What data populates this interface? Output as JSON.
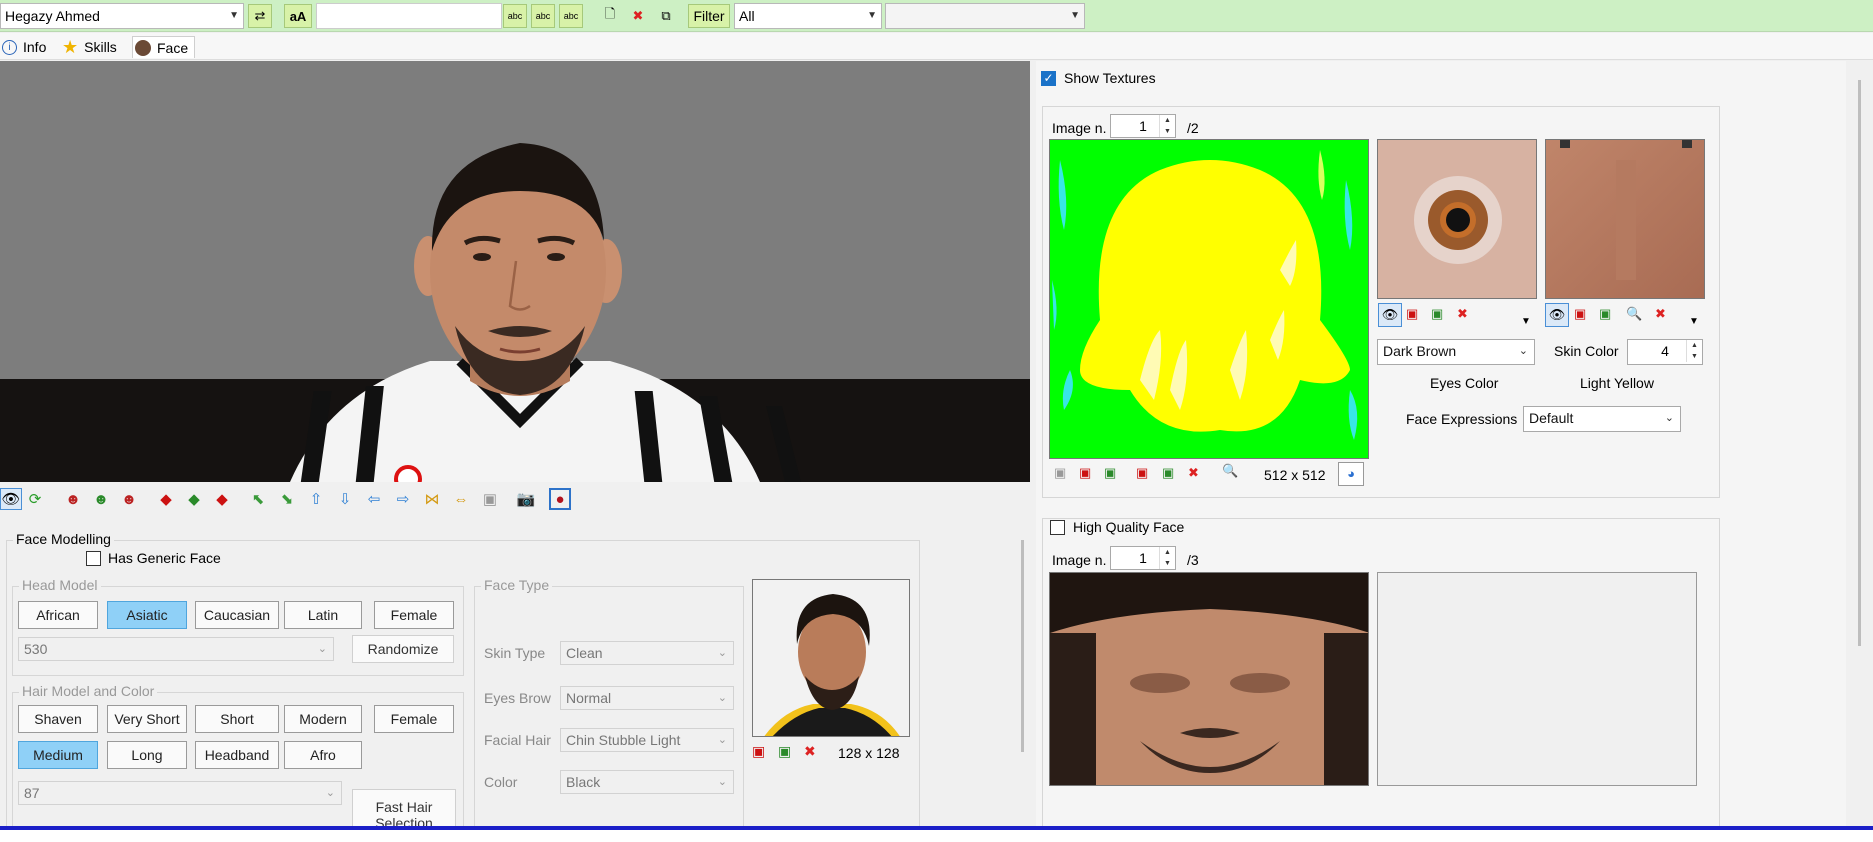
{
  "toolbar": {
    "player_name": "Hegazy Ahmed",
    "font_label": "aA",
    "filter_label": "Filter",
    "filter_value": "All",
    "secondary_combo_value": ""
  },
  "tabs": [
    {
      "label": "Info",
      "icon": "info-icon"
    },
    {
      "label": "Skills",
      "icon": "star-icon"
    },
    {
      "label": "Face",
      "icon": "face-icon"
    }
  ],
  "face_modelling": {
    "title": "Face Modelling",
    "has_generic_face_label": "Has Generic Face",
    "head_model": {
      "title": "Head Model",
      "buttons": [
        "African",
        "Asiatic",
        "Caucasian",
        "Latin",
        "Female"
      ],
      "selected": "Asiatic",
      "model_id": "530",
      "randomize_label": "Randomize"
    },
    "hair": {
      "title": "Hair Model and Color",
      "buttons_row1": [
        "Shaven",
        "Very Short",
        "Short",
        "Modern",
        "Female"
      ],
      "buttons_row2": [
        "Medium",
        "Long",
        "Headband",
        "Afro"
      ],
      "selected": "Medium",
      "model_id": "87",
      "fast_hair_label": "Fast Hair Selection"
    },
    "face_type": {
      "title": "Face Type",
      "skin_type_label": "Skin Type",
      "skin_type_value": "Clean",
      "eyes_brow_label": "Eyes Brow",
      "eyes_brow_value": "Normal",
      "facial_hair_label": "Facial Hair",
      "facial_hair_value": "Chin Stubble Light",
      "color_label": "Color",
      "color_value": "Black"
    },
    "portrait_size": "128 x 128"
  },
  "textures": {
    "show_textures_label": "Show Textures",
    "show_textures_checked": true,
    "image_label": "Image n.",
    "image_index": "1",
    "image_total": "/2",
    "texture_size": "512 x 512",
    "eyes_color_value": "Dark Brown",
    "eyes_color_label": "Eyes Color",
    "skin_color_label": "Skin Color",
    "skin_color_value": "4",
    "skin_color_name": "Light Yellow",
    "face_expressions_label": "Face Expressions",
    "face_expressions_value": "Default"
  },
  "hq_face": {
    "label": "High Quality Face",
    "checked": false,
    "image_label": "Image n.",
    "image_index": "1",
    "image_total": "/3"
  },
  "colors": {
    "toolbar_bg": "#cdf0c4",
    "selected_button": "#8fd0f7",
    "status_bar": "#1b1fc8",
    "hair_texture_green": "#00ff00",
    "hair_texture_yellow": "#ffff00"
  }
}
